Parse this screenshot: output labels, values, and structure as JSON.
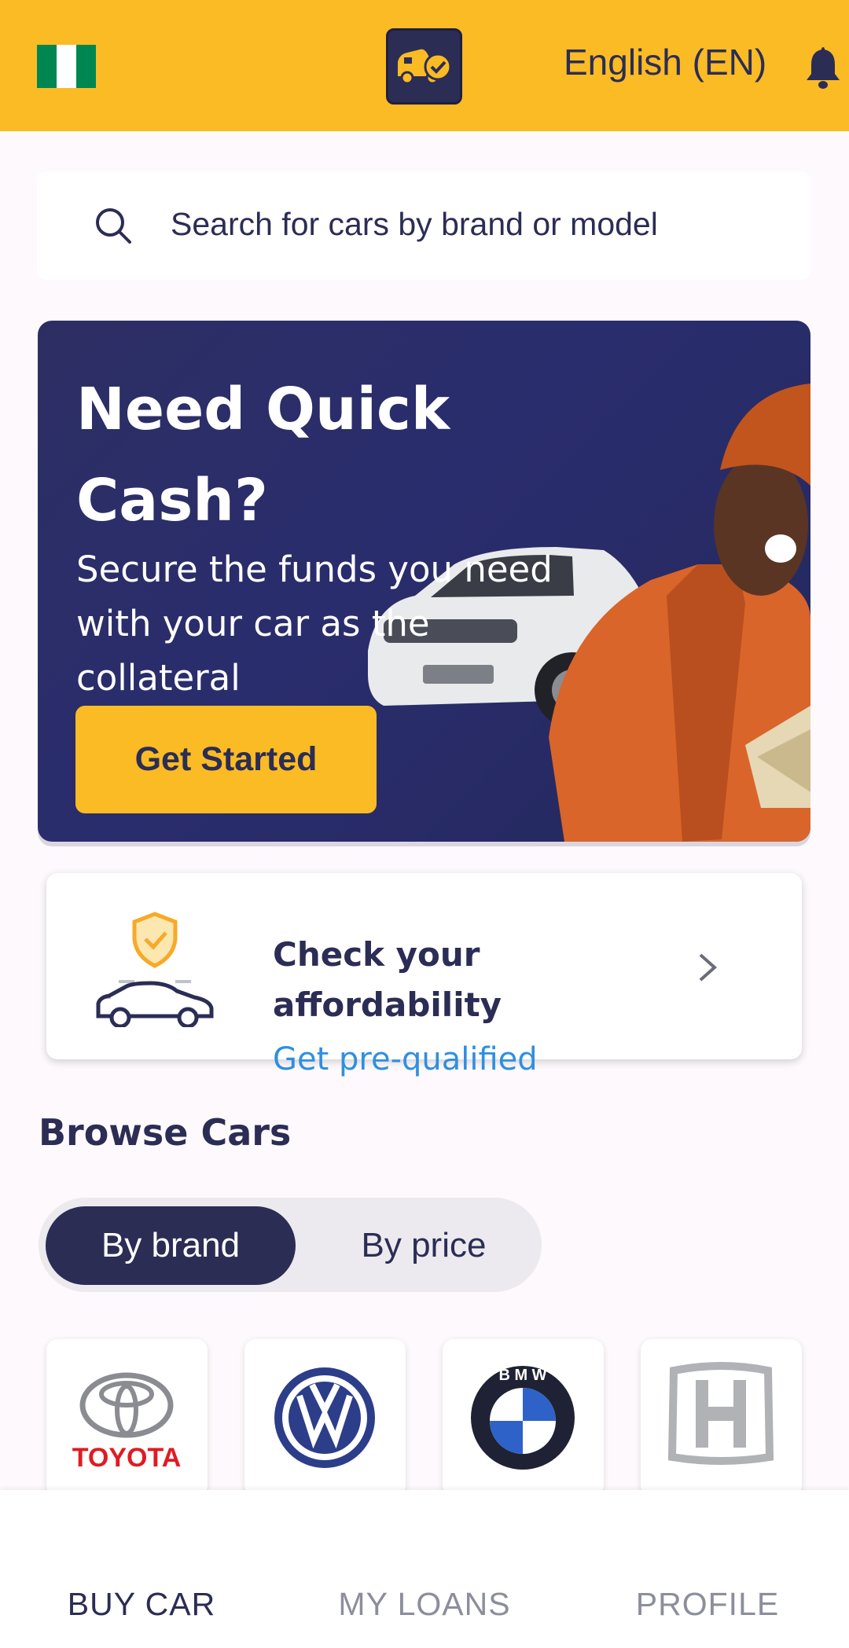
{
  "header": {
    "language": "English (EN)",
    "flag_colors": [
      "#008751",
      "#ffffff",
      "#008751"
    ],
    "icons": {
      "logo": "car-check-logo",
      "notifications": "bell-icon"
    }
  },
  "search": {
    "placeholder": "Search for cars by brand or model",
    "icon": "search-icon"
  },
  "banner": {
    "title": "Need Quick Cash?",
    "subtitle": "Secure the funds you need with your car as the collateral",
    "cta": "Get Started"
  },
  "affordability": {
    "title": "Check your affordability",
    "link": "Get pre-qualified"
  },
  "browse": {
    "title": "Browse Cars",
    "tabs": {
      "active": "By brand",
      "inactive": "By price"
    },
    "brands": [
      {
        "name": "Toyota",
        "label": "TOYOTA"
      },
      {
        "name": "Volkswagen",
        "label": ""
      },
      {
        "name": "BMW",
        "label": "B M W"
      },
      {
        "name": "Honda",
        "label": ""
      }
    ]
  },
  "nav": {
    "items": [
      {
        "label": "BUY CAR",
        "icon": "car-key-icon",
        "active": true
      },
      {
        "label": "MY LOANS",
        "icon": "bank-icon",
        "active": false
      },
      {
        "label": "PROFILE",
        "icon": "menu-icon",
        "active": false
      }
    ]
  },
  "colors": {
    "primary_yellow": "#fbbb24",
    "navy": "#2b2d55",
    "link_blue": "#2f8fe0",
    "inactive_gray": "#8c8e9c"
  }
}
